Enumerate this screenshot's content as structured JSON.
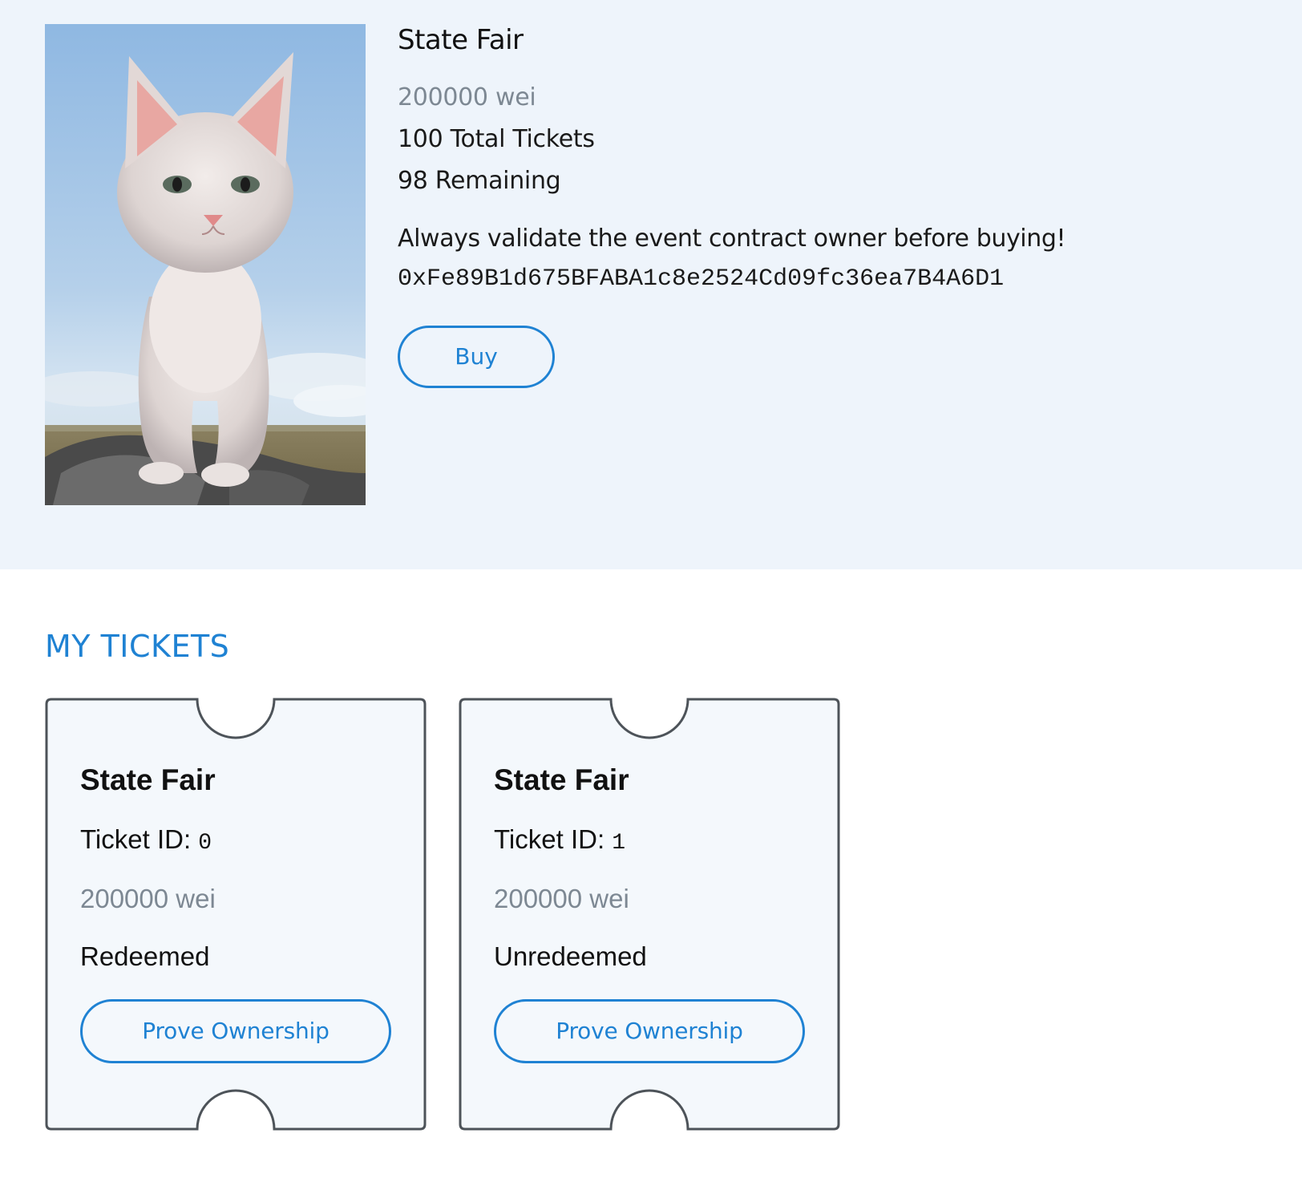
{
  "event": {
    "title": "State Fair",
    "price": "200000 wei",
    "total_tickets": "100 Total Tickets",
    "remaining": "98 Remaining",
    "warning": "Always validate the event contract owner before buying!",
    "owner_address": "0xFe89B1d675BFABA1c8e2524Cd09fc36ea7B4A6D1",
    "buy_label": "Buy",
    "image": "white-kitten-photo"
  },
  "my_tickets": {
    "heading": "MY TICKETS",
    "id_label": "Ticket ID:",
    "prove_label": "Prove Ownership",
    "tickets": [
      {
        "title": "State Fair",
        "id": "0",
        "price": "200000 wei",
        "status": "Redeemed"
      },
      {
        "title": "State Fair",
        "id": "1",
        "price": "200000 wei",
        "status": "Unredeemed"
      }
    ]
  },
  "colors": {
    "accent": "#1f82d3",
    "section_background": "#eef4fb",
    "ticket_background": "#f4f8fc",
    "ticket_border": "#4d5359",
    "muted_text": "#7d8893"
  }
}
